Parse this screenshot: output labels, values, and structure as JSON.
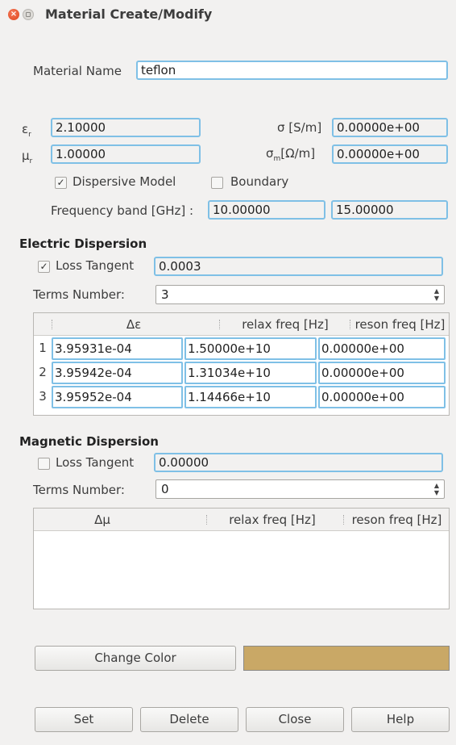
{
  "window": {
    "title": "Material Create/Modify"
  },
  "material": {
    "name_label": "Material Name",
    "name_value": "teflon"
  },
  "props": {
    "eps_label": "ε",
    "eps_sub": "r",
    "eps_value": "2.10000",
    "mu_label": "μ",
    "mu_sub": "r",
    "mu_value": "1.00000",
    "sigma_label": "σ [S/m]",
    "sigma_value": "0.00000e+00",
    "sigma_m_label_a": "σ",
    "sigma_m_sub": "m",
    "sigma_m_label_b": "[Ω/m]",
    "sigma_m_value": "0.00000e+00"
  },
  "options": {
    "dispersive_label": "Dispersive Model",
    "dispersive_checked": true,
    "boundary_label": "Boundary",
    "boundary_checked": false,
    "freq_band_label": "Frequency band [GHz] :",
    "freq_low": "10.00000",
    "freq_high": "15.00000"
  },
  "electric": {
    "heading": "Electric Dispersion",
    "loss_label": "Loss Tangent",
    "loss_checked": true,
    "loss_value": "0.0003",
    "terms_label": "Terms Number:",
    "terms_value": "3",
    "columns": [
      "Δε",
      "relax freq [Hz]",
      "reson freq [Hz]"
    ],
    "rows": [
      {
        "num": "1",
        "delta": "3.95931e-04",
        "relax": "1.50000e+10",
        "reson": "0.00000e+00"
      },
      {
        "num": "2",
        "delta": "3.95942e-04",
        "relax": "1.31034e+10",
        "reson": "0.00000e+00"
      },
      {
        "num": "3",
        "delta": "3.95952e-04",
        "relax": "1.14466e+10",
        "reson": "0.00000e+00"
      }
    ]
  },
  "magnetic": {
    "heading": "Magnetic Dispersion",
    "loss_label": "Loss Tangent",
    "loss_checked": false,
    "loss_value": "0.00000",
    "terms_label": "Terms Number:",
    "terms_value": "0",
    "columns": [
      "Δμ",
      "relax freq [Hz]",
      "reson freq [Hz]"
    ]
  },
  "color": {
    "button_label": "Change Color",
    "swatch": "#c9a866"
  },
  "buttons": {
    "set": "Set",
    "delete": "Delete",
    "close": "Close",
    "help": "Help"
  },
  "icons": {
    "check": "✓",
    "spin_up": "▲",
    "spin_down": "▼",
    "close_x": "×"
  }
}
